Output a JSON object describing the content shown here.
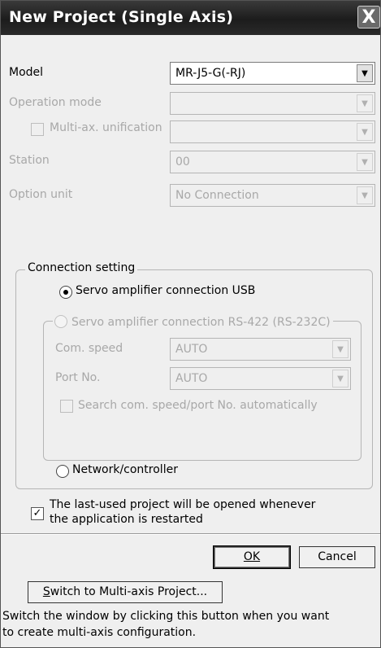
{
  "dialog": {
    "title": "New Project (Single Axis)",
    "close_glyph": "X"
  },
  "fields": {
    "model": {
      "label": "Model",
      "value": "MR-J5-G(-RJ)"
    },
    "operation_mode": {
      "label": "Operation mode",
      "value": ""
    },
    "multi_axis": {
      "label": "Multi-ax. unification",
      "value": "",
      "checked": false
    },
    "station": {
      "label": "Station",
      "value": "00"
    },
    "option_unit": {
      "label": "Option unit",
      "value": "No Connection"
    }
  },
  "connection": {
    "legend": "Connection setting",
    "usb_label": "Servo amplifier connection USB",
    "rs422_label": "Servo amplifier connection RS-422 (RS-232C)",
    "com_speed": {
      "label": "Com. speed",
      "value": "AUTO"
    },
    "port_no": {
      "label": "Port No.",
      "value": "AUTO"
    },
    "search_label": "Search com. speed/port No. automatically",
    "network_label": "Network/controller",
    "selected": "usb"
  },
  "reopen": {
    "checked": true,
    "line1": "The last-used project will be opened whenever",
    "line2": "the application is restarted"
  },
  "buttons": {
    "ok_label": "OK",
    "cancel_label": "Cancel",
    "switch_prefix": "S",
    "switch_rest": "witch to Multi-axis Project..."
  },
  "note": {
    "line1": "Switch the window by clicking this button when you want",
    "line2": "to create multi-axis configuration."
  },
  "icons": {
    "dropdown": "chevron-down-icon",
    "check": "checkmark-icon",
    "close": "close-icon"
  }
}
